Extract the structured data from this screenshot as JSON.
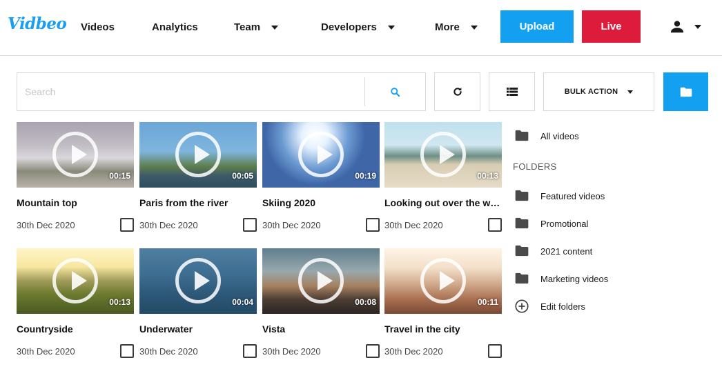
{
  "brand": {
    "logo": "Vidbeo",
    "accent": "#14a0f0",
    "live_color": "#dc1c3a"
  },
  "nav": {
    "items": [
      {
        "label": "Videos",
        "has_dropdown": false
      },
      {
        "label": "Analytics",
        "has_dropdown": false
      },
      {
        "label": "Team",
        "has_dropdown": true
      },
      {
        "label": "Developers",
        "has_dropdown": true
      },
      {
        "label": "More",
        "has_dropdown": true
      }
    ],
    "upload_label": "Upload",
    "live_label": "Live",
    "user_icon": "user-icon"
  },
  "toolbar": {
    "search_placeholder": "Search",
    "search_value": "",
    "search_icon": "search-icon",
    "refresh_icon": "refresh-icon",
    "list_icon": "list-view-icon",
    "bulk_action_label": "BULK ACTION",
    "folder_icon": "folder-icon"
  },
  "videos": [
    {
      "title": "Mountain top",
      "date": "30th Dec 2020",
      "duration": "00:15"
    },
    {
      "title": "Paris from the river",
      "date": "30th Dec 2020",
      "duration": "00:05"
    },
    {
      "title": "Skiing 2020",
      "date": "30th Dec 2020",
      "duration": "00:19"
    },
    {
      "title": "Looking out over the water",
      "date": "30th Dec 2020",
      "duration": "00:13"
    },
    {
      "title": "Countryside",
      "date": "30th Dec 2020",
      "duration": "00:13"
    },
    {
      "title": "Underwater",
      "date": "30th Dec 2020",
      "duration": "00:04"
    },
    {
      "title": "Vista",
      "date": "30th Dec 2020",
      "duration": "00:08"
    },
    {
      "title": "Travel in the city",
      "date": "30th Dec 2020",
      "duration": "00:11"
    }
  ],
  "sidebar": {
    "all_videos_label": "All videos",
    "folders_heading": "FOLDERS",
    "folders": [
      {
        "label": "Featured videos"
      },
      {
        "label": "Promotional"
      },
      {
        "label": "2021 content"
      },
      {
        "label": "Marketing videos"
      }
    ],
    "edit_folders_label": "Edit folders"
  }
}
